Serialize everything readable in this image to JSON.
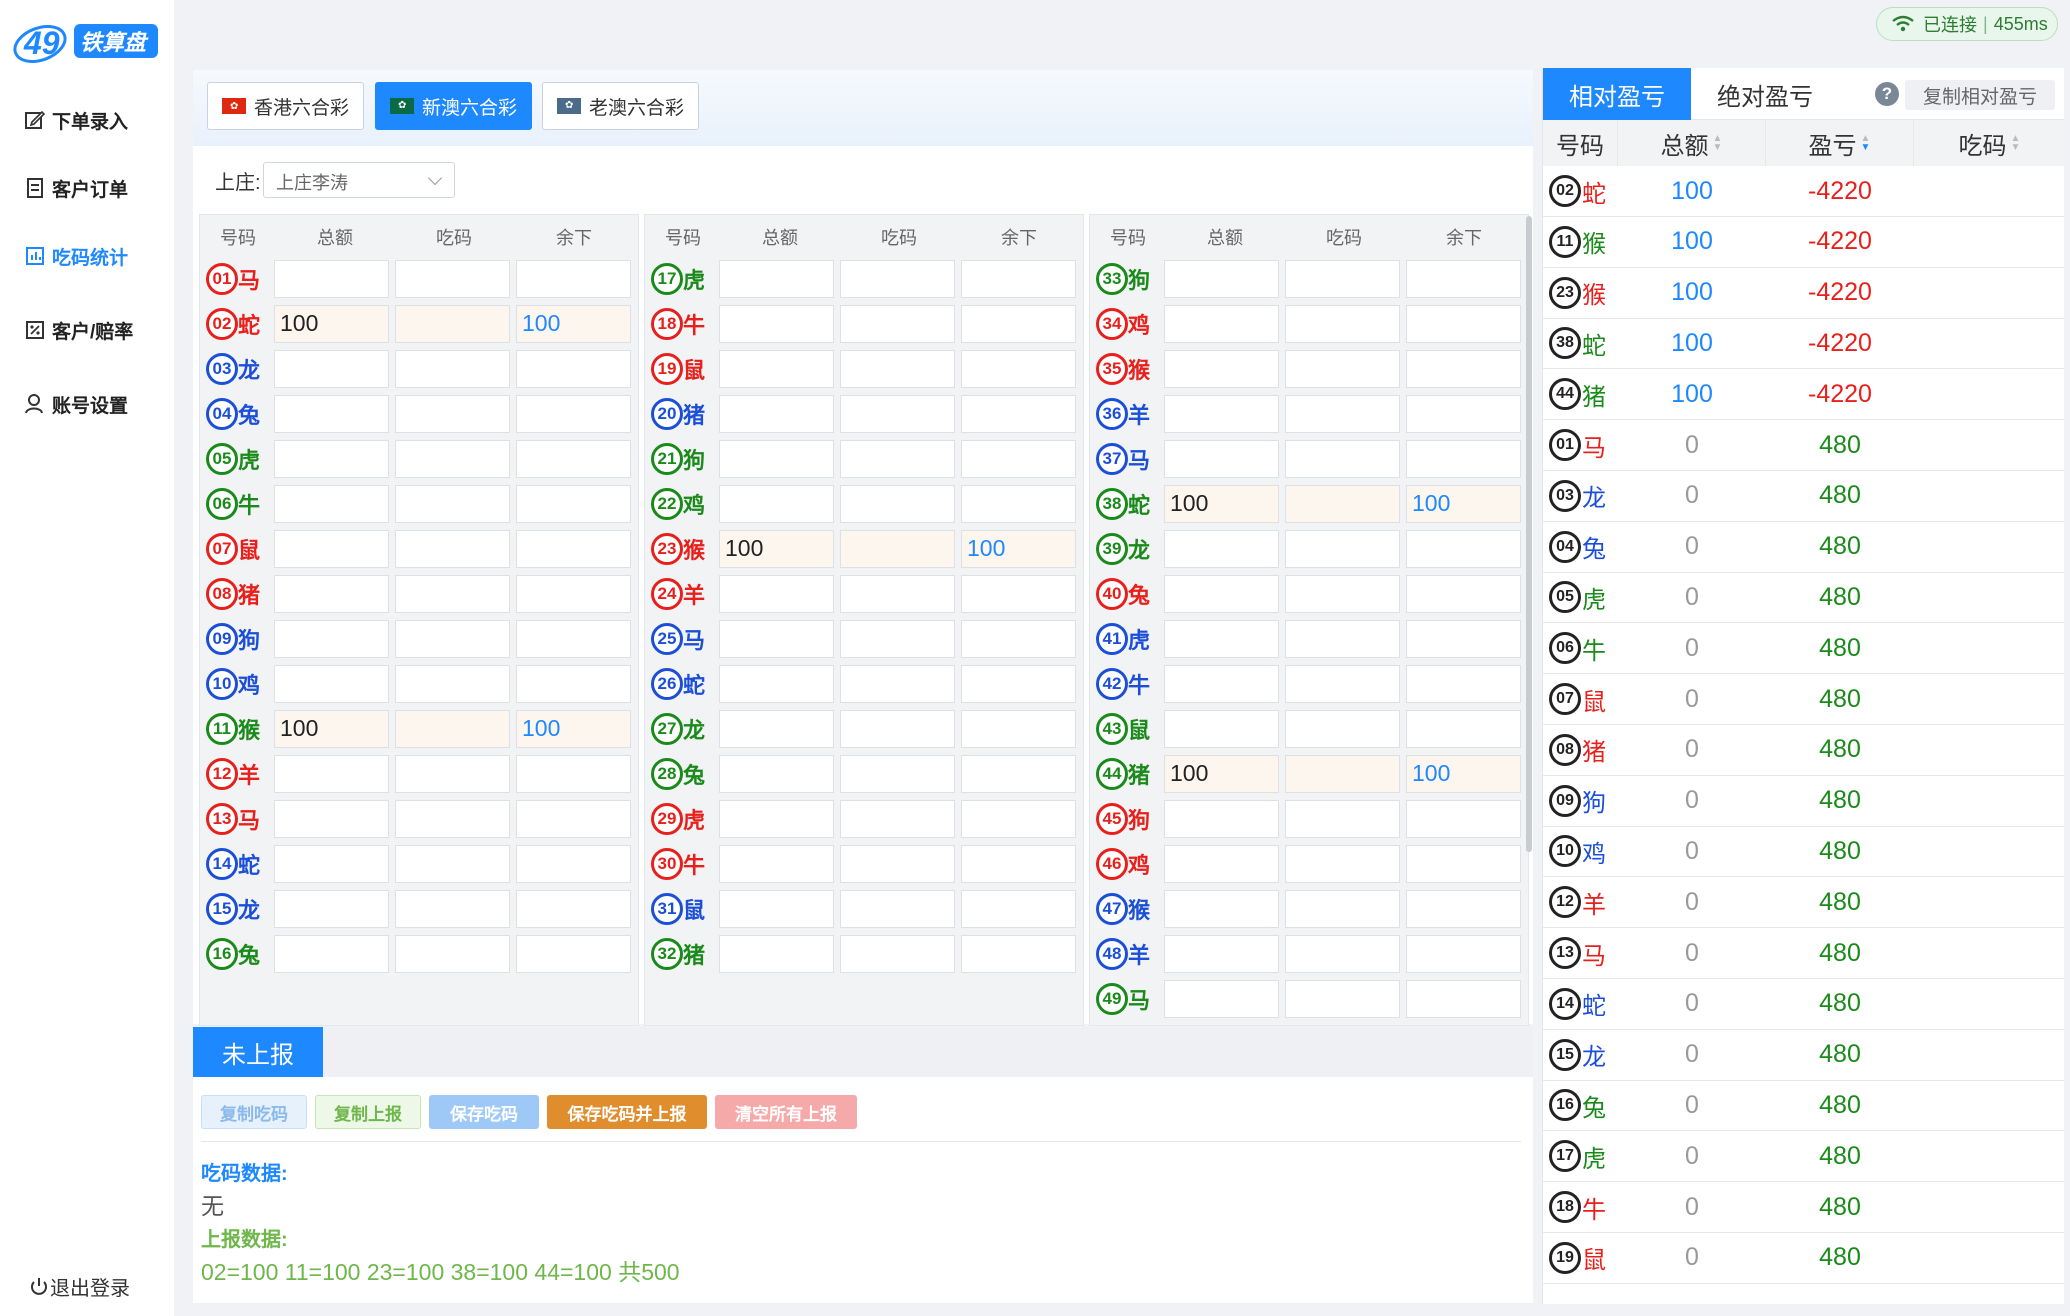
{
  "app": {
    "logo_number": "49",
    "logo_text": "铁算盘"
  },
  "nav": [
    {
      "label": "下单录入",
      "icon": "edit-icon"
    },
    {
      "label": "客户订单",
      "icon": "list-icon"
    },
    {
      "label": "吃码统计",
      "icon": "chart-icon",
      "active": true
    },
    {
      "label": "客户/赔率",
      "icon": "percent-icon"
    },
    {
      "label": "账号设置",
      "icon": "user-icon"
    }
  ],
  "logout": "退出登录",
  "status": {
    "text": "已连接",
    "latency": "455ms"
  },
  "lottery_tabs": [
    {
      "label": "香港六合彩",
      "flag": "hk-flag-icon"
    },
    {
      "label": "新澳六合彩",
      "flag": "macau-flag-icon",
      "active": true
    },
    {
      "label": "老澳六合彩",
      "flag": "macau-flag-icon"
    }
  ],
  "banker": {
    "label": "上庄:",
    "selected": "上庄李涛"
  },
  "grid_headers": [
    "号码",
    "总额",
    "吃码",
    "余下"
  ],
  "numbers": [
    {
      "n": "01",
      "z": "马",
      "c": "r"
    },
    {
      "n": "02",
      "z": "蛇",
      "c": "r",
      "total": "100",
      "rest": "100"
    },
    {
      "n": "03",
      "z": "龙",
      "c": "b"
    },
    {
      "n": "04",
      "z": "兔",
      "c": "b"
    },
    {
      "n": "05",
      "z": "虎",
      "c": "g"
    },
    {
      "n": "06",
      "z": "牛",
      "c": "g"
    },
    {
      "n": "07",
      "z": "鼠",
      "c": "r"
    },
    {
      "n": "08",
      "z": "猪",
      "c": "r"
    },
    {
      "n": "09",
      "z": "狗",
      "c": "b"
    },
    {
      "n": "10",
      "z": "鸡",
      "c": "b"
    },
    {
      "n": "11",
      "z": "猴",
      "c": "g",
      "total": "100",
      "rest": "100"
    },
    {
      "n": "12",
      "z": "羊",
      "c": "r"
    },
    {
      "n": "13",
      "z": "马",
      "c": "r"
    },
    {
      "n": "14",
      "z": "蛇",
      "c": "b"
    },
    {
      "n": "15",
      "z": "龙",
      "c": "b"
    },
    {
      "n": "16",
      "z": "兔",
      "c": "g"
    },
    {
      "n": "17",
      "z": "虎",
      "c": "g"
    },
    {
      "n": "18",
      "z": "牛",
      "c": "r"
    },
    {
      "n": "19",
      "z": "鼠",
      "c": "r"
    },
    {
      "n": "20",
      "z": "猪",
      "c": "b"
    },
    {
      "n": "21",
      "z": "狗",
      "c": "g"
    },
    {
      "n": "22",
      "z": "鸡",
      "c": "g"
    },
    {
      "n": "23",
      "z": "猴",
      "c": "r",
      "total": "100",
      "rest": "100"
    },
    {
      "n": "24",
      "z": "羊",
      "c": "r"
    },
    {
      "n": "25",
      "z": "马",
      "c": "b"
    },
    {
      "n": "26",
      "z": "蛇",
      "c": "b"
    },
    {
      "n": "27",
      "z": "龙",
      "c": "g"
    },
    {
      "n": "28",
      "z": "兔",
      "c": "g"
    },
    {
      "n": "29",
      "z": "虎",
      "c": "r"
    },
    {
      "n": "30",
      "z": "牛",
      "c": "r"
    },
    {
      "n": "31",
      "z": "鼠",
      "c": "b"
    },
    {
      "n": "32",
      "z": "猪",
      "c": "g"
    },
    {
      "n": "33",
      "z": "狗",
      "c": "g"
    },
    {
      "n": "34",
      "z": "鸡",
      "c": "r"
    },
    {
      "n": "35",
      "z": "猴",
      "c": "r"
    },
    {
      "n": "36",
      "z": "羊",
      "c": "b"
    },
    {
      "n": "37",
      "z": "马",
      "c": "b"
    },
    {
      "n": "38",
      "z": "蛇",
      "c": "g",
      "total": "100",
      "rest": "100"
    },
    {
      "n": "39",
      "z": "龙",
      "c": "g"
    },
    {
      "n": "40",
      "z": "兔",
      "c": "r"
    },
    {
      "n": "41",
      "z": "虎",
      "c": "b"
    },
    {
      "n": "42",
      "z": "牛",
      "c": "b"
    },
    {
      "n": "43",
      "z": "鼠",
      "c": "g"
    },
    {
      "n": "44",
      "z": "猪",
      "c": "g",
      "total": "100",
      "rest": "100"
    },
    {
      "n": "45",
      "z": "狗",
      "c": "r"
    },
    {
      "n": "46",
      "z": "鸡",
      "c": "r"
    },
    {
      "n": "47",
      "z": "猴",
      "c": "b"
    },
    {
      "n": "48",
      "z": "羊",
      "c": "b"
    },
    {
      "n": "49",
      "z": "马",
      "c": "g"
    }
  ],
  "bottom": {
    "tab": "未上报",
    "buttons": [
      {
        "label": "复制吃码",
        "bg": "#e6f1fc",
        "fg": "#8ab9ec",
        "border": "#c8defa"
      },
      {
        "label": "复制上报",
        "bg": "#eef8e8",
        "fg": "#6fb64b",
        "border": "#c5e6b4"
      },
      {
        "label": "保存吃码",
        "bg": "#9ec9f7",
        "fg": "#ffffff",
        "border": "#9ec9f7"
      },
      {
        "label": "保存吃码并上报",
        "bg": "#e08d2e",
        "fg": "#ffffff",
        "border": "#e08d2e"
      },
      {
        "label": "清空所有上报",
        "bg": "#f6a9a9",
        "fg": "#ffffff",
        "border": "#f6a9a9"
      }
    ],
    "eat_label": "吃码数据:",
    "eat_value": "无",
    "report_label": "上报数据:",
    "report_value": "02=100 11=100 23=100 38=100 44=100 共500"
  },
  "right_panel": {
    "tabs": [
      "相对盈亏",
      "绝对盈亏"
    ],
    "copy_label": "复制相对盈亏",
    "headers": [
      "号码",
      "总额",
      "盈亏",
      "吃码"
    ],
    "rows": [
      {
        "n": "02",
        "z": "蛇",
        "c": "r",
        "total": "100",
        "pl": "-4220"
      },
      {
        "n": "11",
        "z": "猴",
        "c": "g",
        "total": "100",
        "pl": "-4220"
      },
      {
        "n": "23",
        "z": "猴",
        "c": "r",
        "total": "100",
        "pl": "-4220"
      },
      {
        "n": "38",
        "z": "蛇",
        "c": "g",
        "total": "100",
        "pl": "-4220"
      },
      {
        "n": "44",
        "z": "猪",
        "c": "g",
        "total": "100",
        "pl": "-4220"
      },
      {
        "n": "01",
        "z": "马",
        "c": "r",
        "total": "0",
        "pl": "480"
      },
      {
        "n": "03",
        "z": "龙",
        "c": "b",
        "total": "0",
        "pl": "480"
      },
      {
        "n": "04",
        "z": "兔",
        "c": "b",
        "total": "0",
        "pl": "480"
      },
      {
        "n": "05",
        "z": "虎",
        "c": "g",
        "total": "0",
        "pl": "480"
      },
      {
        "n": "06",
        "z": "牛",
        "c": "g",
        "total": "0",
        "pl": "480"
      },
      {
        "n": "07",
        "z": "鼠",
        "c": "r",
        "total": "0",
        "pl": "480"
      },
      {
        "n": "08",
        "z": "猪",
        "c": "r",
        "total": "0",
        "pl": "480"
      },
      {
        "n": "09",
        "z": "狗",
        "c": "b",
        "total": "0",
        "pl": "480"
      },
      {
        "n": "10",
        "z": "鸡",
        "c": "b",
        "total": "0",
        "pl": "480"
      },
      {
        "n": "12",
        "z": "羊",
        "c": "r",
        "total": "0",
        "pl": "480"
      },
      {
        "n": "13",
        "z": "马",
        "c": "r",
        "total": "0",
        "pl": "480"
      },
      {
        "n": "14",
        "z": "蛇",
        "c": "b",
        "total": "0",
        "pl": "480"
      },
      {
        "n": "15",
        "z": "龙",
        "c": "b",
        "total": "0",
        "pl": "480"
      },
      {
        "n": "16",
        "z": "兔",
        "c": "g",
        "total": "0",
        "pl": "480"
      },
      {
        "n": "17",
        "z": "虎",
        "c": "g",
        "total": "0",
        "pl": "480"
      },
      {
        "n": "18",
        "z": "牛",
        "c": "r",
        "total": "0",
        "pl": "480"
      },
      {
        "n": "19",
        "z": "鼠",
        "c": "r",
        "total": "0",
        "pl": "480"
      }
    ]
  }
}
